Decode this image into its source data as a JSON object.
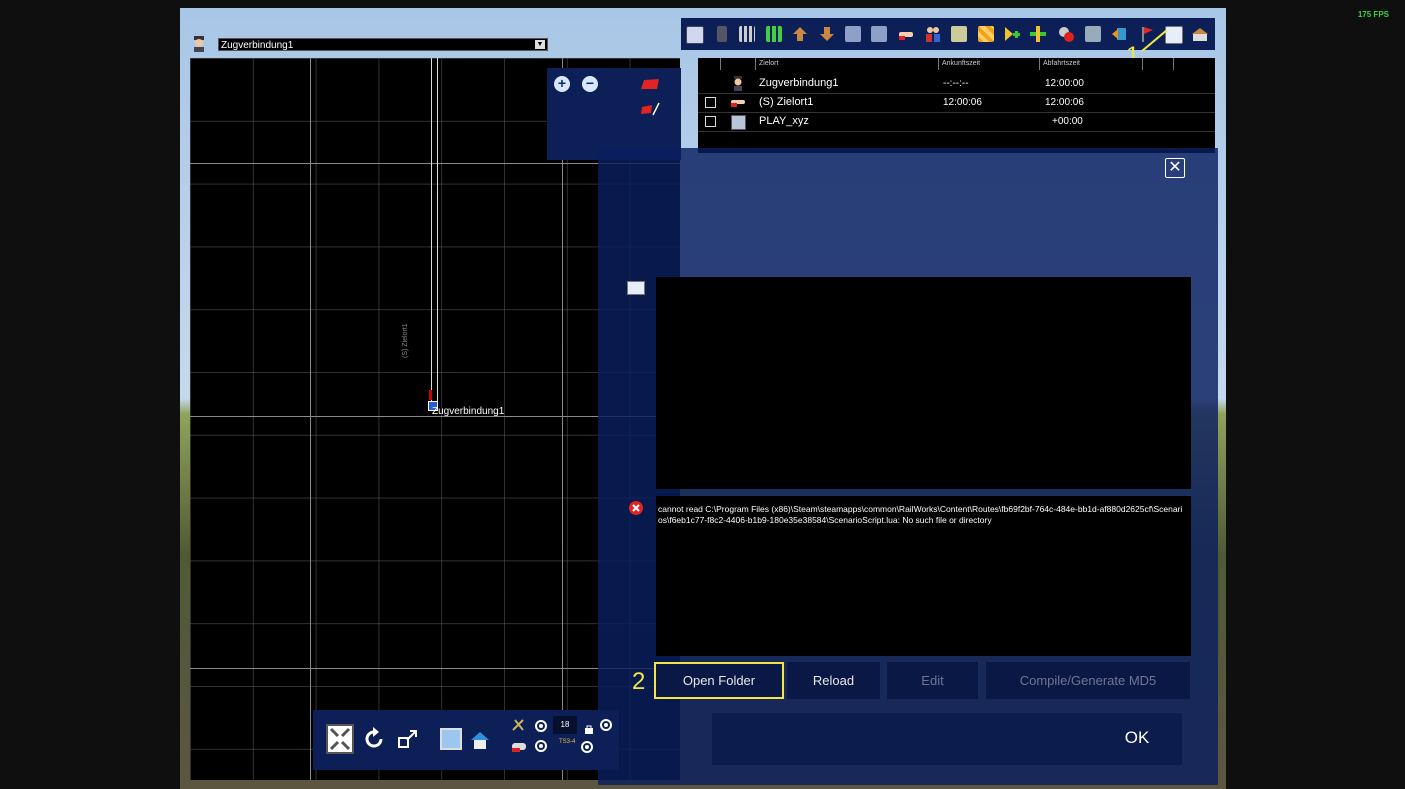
{
  "fps": "175 FPS",
  "train_selector": {
    "value": "Zugverbindung1"
  },
  "map": {
    "train_label": "Zugverbindung1",
    "track_label": "(S) Zielort1"
  },
  "toolbar": {
    "annotation": "1",
    "icons": [
      "save-icon",
      "delete-icon",
      "grid-small-icon",
      "grid-large-icon",
      "move-up-icon",
      "move-down-icon",
      "insert-before-icon",
      "insert-after-icon",
      "pointing-hand-icon",
      "people-icon",
      "check-icon",
      "cubes-icon",
      "add-instruction-icon",
      "add-stop-icon",
      "remove-icon",
      "properties-icon",
      "export-icon",
      "flag-icon",
      "script-icon",
      "station-icon"
    ]
  },
  "table": {
    "headers": [
      "Zielort",
      "Ankunftszeit",
      "Abfahrtszeit"
    ],
    "rows": [
      {
        "icon": "driver-icon",
        "name": "Zugverbindung1",
        "arrival": "--:--:--",
        "departure": "12:00:00",
        "checkbox": false
      },
      {
        "icon": "pointing-hand-icon",
        "name": "(S) Zielort1",
        "arrival": "12:00:06",
        "departure": "12:00:06",
        "checkbox": true
      },
      {
        "icon": "script-settings-icon",
        "name": "PLAY_xyz",
        "arrival": "",
        "departure": "+00:00",
        "checkbox": true
      }
    ]
  },
  "dialog": {
    "close_label": "✕",
    "error_message": "cannot read C:\\Program Files (x86)\\Steam\\steamapps\\common\\RailWorks\\Content\\Routes\\fb69f2bf-764c-484e-bb1d-af880d2625cf\\Scenarios\\f6eb1c77-f8c2-4406-b1b9-180e35e38584\\ScenarioScript.lua: No such file or directory",
    "buttons": {
      "open_folder": "Open Folder",
      "reload": "Reload",
      "edit": "Edit",
      "compile": "Compile/Generate MD5"
    },
    "annotation": "2",
    "ok": "OK"
  },
  "bottombar": {
    "counter": "18",
    "label_tsc": "TS3-4"
  },
  "colors": {
    "accent_yellow": "#f0e646",
    "panel_blue": "#0c1f56"
  }
}
